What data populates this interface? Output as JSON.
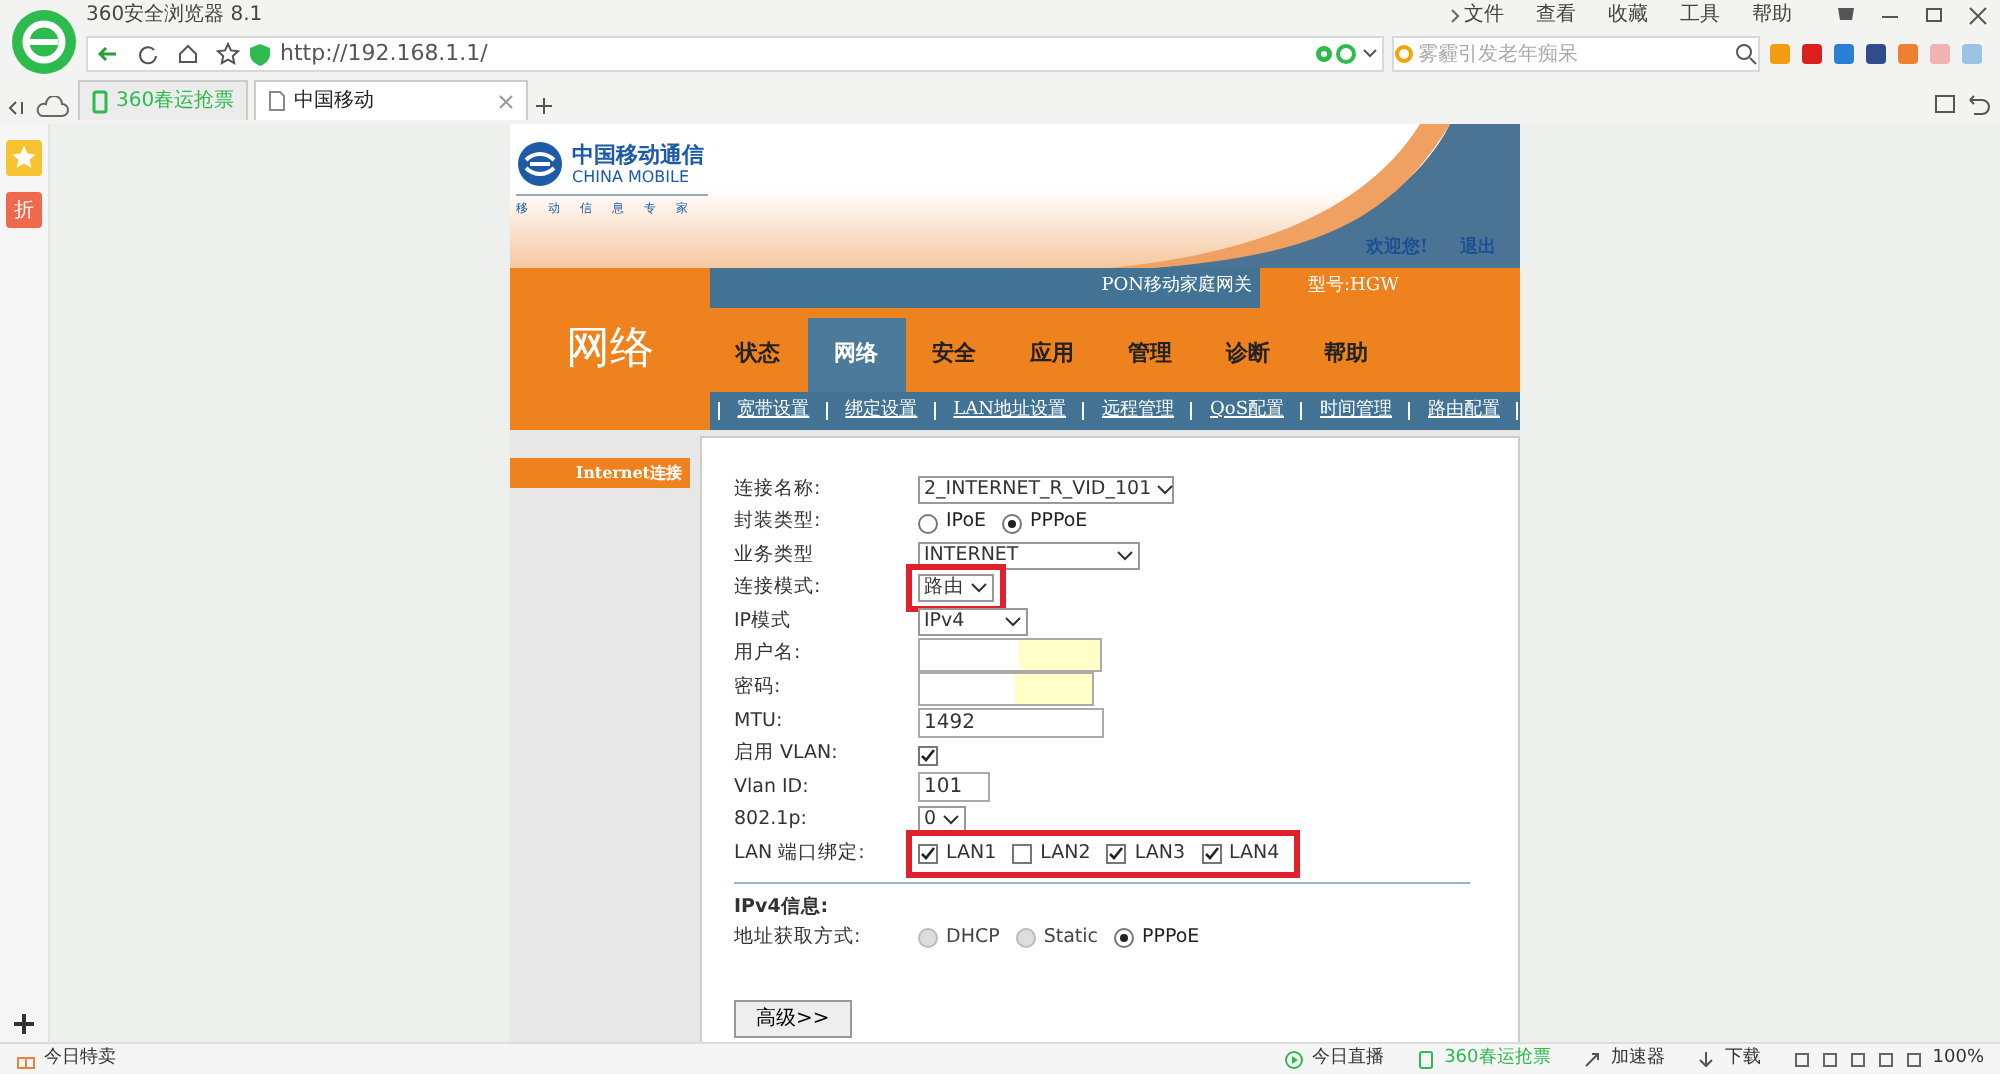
{
  "browser": {
    "title": "360安全浏览器 8.1",
    "url": "http://192.168.1.1/",
    "search_placeholder": "雾霾引发老年痴呆",
    "menu": [
      "文件",
      "查看",
      "收藏",
      "工具",
      "帮助"
    ],
    "tabs": [
      {
        "label": "360春运抢票",
        "selected": false
      },
      {
        "label": "中国移动",
        "selected": true
      }
    ],
    "side_deal": "折",
    "status_left": "今日特卖",
    "status_items": [
      "今日直播",
      "360春运抢票",
      "加速器",
      "下载",
      "100%"
    ]
  },
  "router": {
    "brand_cn": "中国移动通信",
    "brand_en": "CHINA MOBILE",
    "slogan": "移动信息专家",
    "welcome": "欢迎您!",
    "logout": "退出",
    "section": "网络",
    "gateway": "PON移动家庭网关",
    "model": "型号:HGW",
    "nav": [
      {
        "label": "状态",
        "selected": false
      },
      {
        "label": "网络",
        "selected": true
      },
      {
        "label": "安全",
        "selected": false
      },
      {
        "label": "应用",
        "selected": false
      },
      {
        "label": "管理",
        "selected": false
      },
      {
        "label": "诊断",
        "selected": false
      },
      {
        "label": "帮助",
        "selected": false
      }
    ],
    "subnav": [
      "宽带设置",
      "绑定设置",
      "LAN地址设置",
      "远程管理",
      "QoS配置",
      "时间管理",
      "路由配置"
    ],
    "side_menu": [
      {
        "label": "Internet连接",
        "selected": true
      }
    ],
    "rows": [
      {
        "kind": "select",
        "label": "连接名称:",
        "value": "2_INTERNET_R_VID_101"
      },
      {
        "kind": "radio",
        "label": "封装类型:",
        "options": [
          {
            "label": "IPoE",
            "selected": false,
            "disabled": false
          },
          {
            "label": "PPPoE",
            "selected": true,
            "disabled": false
          }
        ]
      },
      {
        "kind": "select",
        "label": "业务类型",
        "value": "INTERNET"
      },
      {
        "kind": "select",
        "label": "连接模式:",
        "value": "路由",
        "highlighted": true
      },
      {
        "kind": "select",
        "label": "IP模式",
        "value": "IPv4"
      },
      {
        "kind": "text",
        "label": "用户名:",
        "autofill": true
      },
      {
        "kind": "text",
        "label": "密码:",
        "autofill": true
      },
      {
        "kind": "text",
        "label": "MTU:",
        "value": "1492"
      },
      {
        "kind": "checkbox",
        "label": "启用 VLAN:",
        "checked": true
      },
      {
        "kind": "text",
        "label": "Vlan ID:",
        "value": "101"
      },
      {
        "kind": "select",
        "label": "802.1p:",
        "value": "0"
      },
      {
        "kind": "checks",
        "label": "LAN 端口绑定:",
        "highlighted": true,
        "options": [
          {
            "label": "LAN1",
            "checked": true
          },
          {
            "label": "LAN2",
            "checked": false
          },
          {
            "label": "LAN3",
            "checked": true
          },
          {
            "label": "LAN4",
            "checked": true
          }
        ]
      },
      {
        "kind": "divider"
      },
      {
        "kind": "heading",
        "label": "IPv4信息:"
      },
      {
        "kind": "radio",
        "label": "地址获取方式:",
        "options": [
          {
            "label": "DHCP",
            "selected": false,
            "disabled": true
          },
          {
            "label": "Static",
            "selected": false,
            "disabled": true
          },
          {
            "label": "PPPoE",
            "selected": true,
            "disabled": false
          }
        ]
      }
    ],
    "advanced_button": "高级>>"
  }
}
